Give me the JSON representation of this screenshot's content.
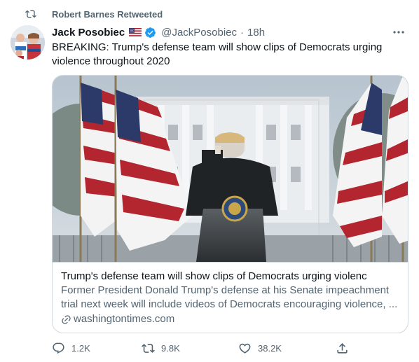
{
  "retweet": {
    "label": "Robert Barnes Retweeted",
    "icon": "retweet-icon"
  },
  "author": {
    "display_name": "Jack Posobiec",
    "flag_icon": "us-flag-icon",
    "verified_icon": "verified-badge-icon",
    "handle": "@JackPosobiec",
    "separator": "·",
    "time": "18h"
  },
  "tweet": {
    "text": "BREAKING: Trump's defense team will show clips of Democrats urging violence throughout 2020"
  },
  "card": {
    "title": "Trump's defense team will show clips of Democrats urging violenc",
    "description": "Former President Donald Trump's defense at his Senate impeachment trial next week will include videos of Democrats encouraging violence, ...",
    "domain": "washingtontimes.com"
  },
  "actions": {
    "reply_count": "1.2K",
    "retweet_count": "9.8K",
    "like_count": "38.2K"
  },
  "colors": {
    "text_primary": "#0f1419",
    "text_secondary": "#536471",
    "verified_blue": "#1d9bf0",
    "border": "#cfd9de"
  }
}
